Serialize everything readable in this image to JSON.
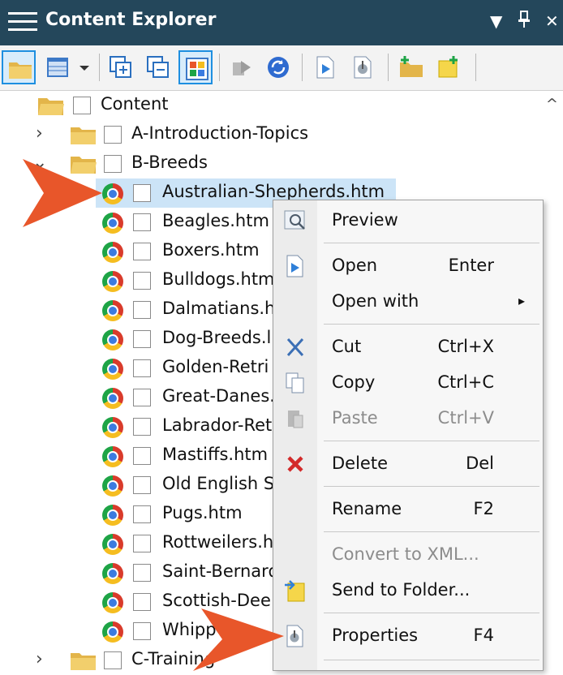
{
  "window": {
    "title": "Content Explorer",
    "buttons": [
      "▼",
      "📌",
      "✕"
    ]
  },
  "toolbar": {
    "icons": [
      "open-folder-icon",
      "grid-view-icon",
      "dropdown-arrow-icon",
      "expand-all-icon",
      "collapse-all-icon",
      "color-grid-icon",
      "move-icon",
      "sync-icon",
      "open-file-icon",
      "properties-icon",
      "new-folder-icon",
      "new-item-icon"
    ]
  },
  "tree": {
    "root": "Content",
    "folders": [
      "A-Introduction-Topics",
      "B-Breeds",
      "C-Training"
    ],
    "files": [
      "Australian-Shepherds.htm",
      "Beagles.htm",
      "Boxers.htm",
      "Bulldogs.htm",
      "Dalmatians.h",
      "Dog-Breeds.l",
      "Golden-Retri",
      "Great-Danes.",
      "Labrador-Ret",
      "Mastiffs.htm",
      "Old English S",
      "Pugs.htm",
      "Rottweilers.h",
      "Saint-Bernard",
      "Scottish-Dee",
      "Whipp"
    ]
  },
  "context_menu": {
    "items": [
      {
        "label": "Preview",
        "shortcut": "",
        "icon": "preview-icon"
      },
      {
        "label": "Open",
        "shortcut": "Enter",
        "icon": "open-file-icon"
      },
      {
        "label": "Open with",
        "shortcut": "",
        "icon": "",
        "submenu": "▸"
      },
      {
        "label": "Cut",
        "shortcut": "Ctrl+X",
        "icon": "scissors-icon"
      },
      {
        "label": "Copy",
        "shortcut": "Ctrl+C",
        "icon": "copy-icon"
      },
      {
        "label": "Paste",
        "shortcut": "Ctrl+V",
        "icon": "paste-icon",
        "disabled": true
      },
      {
        "label": "Delete",
        "shortcut": "Del",
        "icon": "delete-icon"
      },
      {
        "label": "Rename",
        "shortcut": "F2",
        "icon": ""
      },
      {
        "label": "Convert to XML...",
        "shortcut": "",
        "icon": "",
        "disabled": true
      },
      {
        "label": "Send to Folder...",
        "shortcut": "",
        "icon": "send-to-folder-icon"
      },
      {
        "label": "Properties",
        "shortcut": "F4",
        "icon": "properties-icon"
      }
    ]
  },
  "colors": {
    "titlebar": "#24475b",
    "selection": "#cce4f7",
    "callout_arrow": "#e8562a"
  }
}
